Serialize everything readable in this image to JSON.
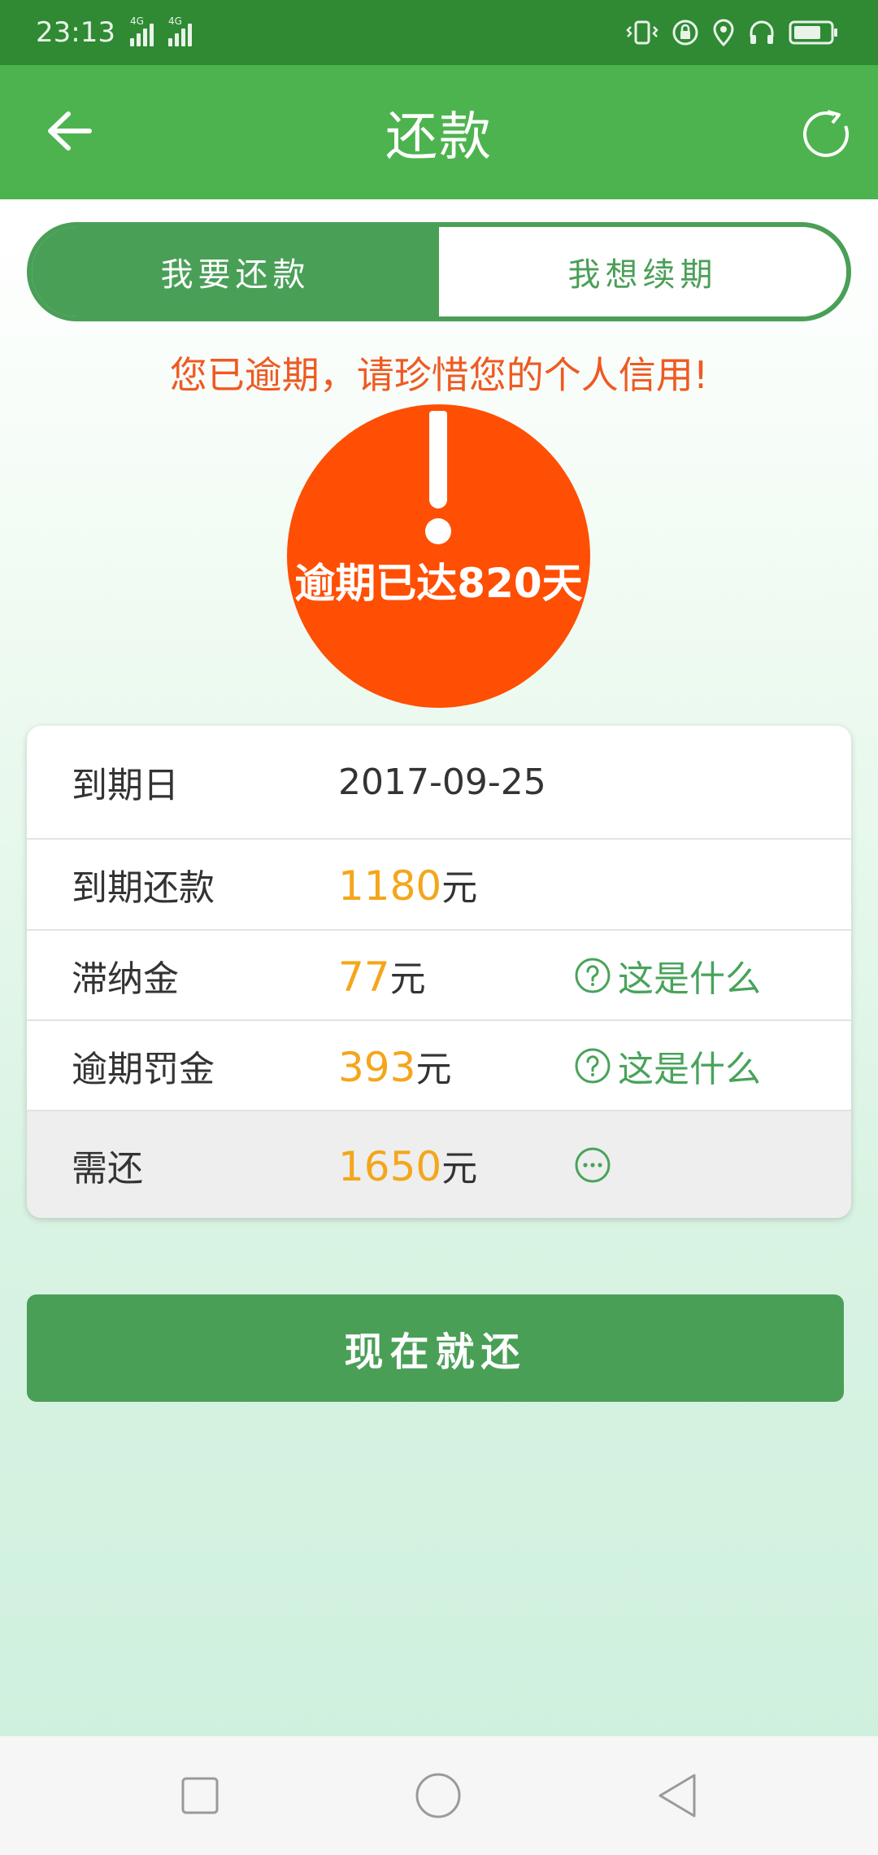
{
  "status_bar": {
    "time": "23:13",
    "network_1": "4G",
    "network_2": "4G"
  },
  "header": {
    "title": "还款",
    "back_icon": "arrow-left-icon",
    "refresh_icon": "refresh-icon"
  },
  "segment": {
    "tabs": [
      {
        "label": "我要还款",
        "active": true
      },
      {
        "label": "我想续期",
        "active": false
      }
    ]
  },
  "warning": "您已逾期，请珍惜您的个人信用!",
  "alert": {
    "overdue_text": "逾期已达820天"
  },
  "details": {
    "rows": [
      {
        "label": "到期日",
        "value": "2017-09-25"
      },
      {
        "label": "到期还款",
        "amount": "1180",
        "unit": "元"
      },
      {
        "label": "滞纳金",
        "amount": "77",
        "unit": "元",
        "help": "这是什么"
      },
      {
        "label": "逾期罚金",
        "amount": "393",
        "unit": "元",
        "help": "这是什么"
      },
      {
        "label": "需还",
        "amount": "1650",
        "unit": "元"
      }
    ]
  },
  "pay_button": "现在就还",
  "colors": {
    "status_bar": "#2f8a33",
    "header": "#4db34f",
    "accent_green": "#4a9f57",
    "alert_orange": "#fe4f04",
    "warning_text": "#ee5a22",
    "amount_text": "#f4a61b"
  }
}
